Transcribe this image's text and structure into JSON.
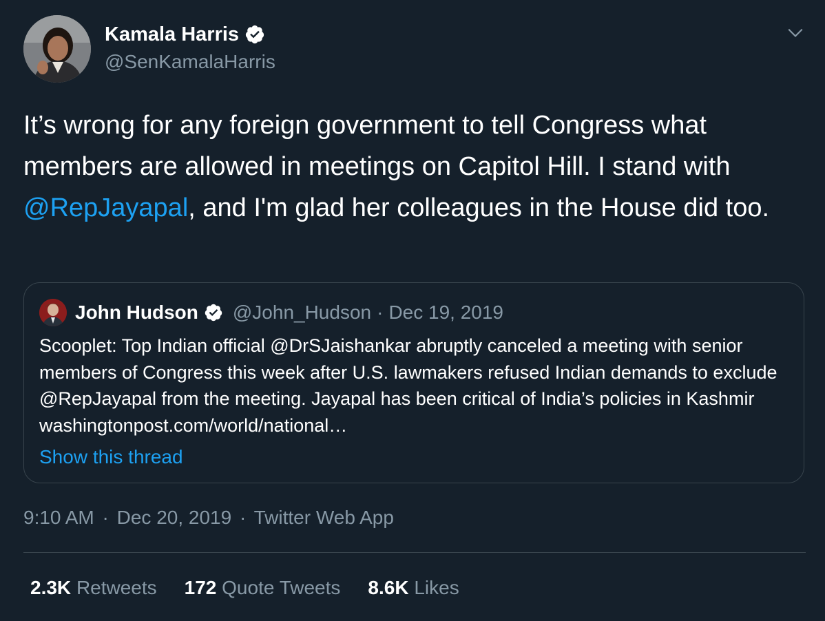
{
  "author": {
    "name": "Kamala Harris",
    "handle": "@SenKamalaHarris",
    "avatar_icon": "profile-photo-icon",
    "verified_icon": "verified-badge-icon"
  },
  "menu_icon": "chevron-down-icon",
  "tweet": {
    "text_part1": "It’s wrong for any foreign government to tell Congress what members are allowed in meetings on Capitol Hill. I stand with ",
    "mention": "@RepJayapal",
    "text_part2": ", and I'm glad her colleagues in the House did too."
  },
  "quoted_tweet": {
    "name": "John Hudson",
    "handle": "@John_Hudson",
    "separator": "·",
    "date": "Dec 19, 2019",
    "text": "Scooplet: Top Indian official @DrSJaishankar abruptly canceled a meeting with senior members of Congress this week after U.S. lawmakers refused Indian demands to exclude @RepJayapal from the meeting. Jayapal has been critical of India’s policies in Kashmir washingtonpost.com/world/national…",
    "show_thread": "Show this thread"
  },
  "timestamp": {
    "time": "9:10 AM",
    "sep1": "·",
    "date": "Dec 20, 2019",
    "sep2": "·",
    "source": "Twitter Web App"
  },
  "stats": [
    {
      "count": "2.3K",
      "label": "Retweets"
    },
    {
      "count": "172",
      "label": "Quote Tweets"
    },
    {
      "count": "8.6K",
      "label": "Likes"
    }
  ],
  "colors": {
    "background": "#15202b",
    "accent": "#1da1f2",
    "secondary_text": "#8899a6",
    "border": "#38444d"
  }
}
